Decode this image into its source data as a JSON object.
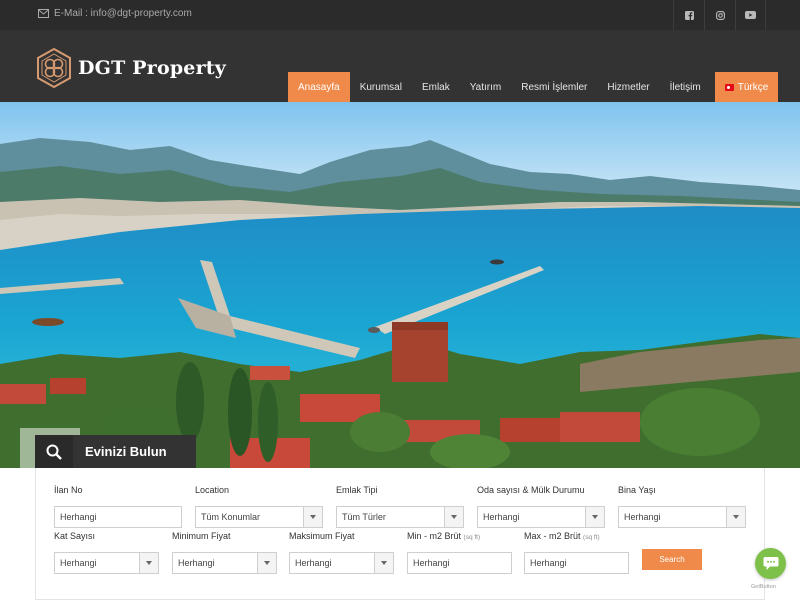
{
  "topbar": {
    "email": "E-Mail : info@dgt-property.com",
    "social_icons": [
      "facebook-icon",
      "instagram-icon",
      "youtube-icon"
    ]
  },
  "header": {
    "brand": "DGT Property",
    "nav": [
      {
        "label": "Anasayfa",
        "active": true
      },
      {
        "label": "Kurumsal"
      },
      {
        "label": "Emlak"
      },
      {
        "label": "Yatırım"
      },
      {
        "label": "Resmi İşlemler"
      },
      {
        "label": "Hizmetler"
      },
      {
        "label": "İletişim"
      }
    ],
    "language": "Türkçe"
  },
  "search": {
    "title": "Evinizi Bulun",
    "row1": [
      {
        "label": "İlan No",
        "value": "Herhangi"
      },
      {
        "label": "Location",
        "value": "Tüm Konumlar"
      },
      {
        "label": "Emlak Tipi",
        "value": "Tüm Türler"
      },
      {
        "label": "Oda sayısı & Mülk Durumu",
        "value": "Herhangi"
      },
      {
        "label": "Bina Yaşı",
        "value": "Herhangi"
      }
    ],
    "row2": [
      {
        "label": "Kat Sayısı",
        "value": "Herhangi"
      },
      {
        "label": "Minimum Fiyat",
        "value": "Herhangi"
      },
      {
        "label": "Maksimum Fiyat",
        "value": "Herhangi"
      },
      {
        "label": "Min - m2 Brüt",
        "unit": "(sq ft)",
        "placeholder": "Herhangi"
      },
      {
        "label": "Max - m2 Brüt",
        "unit": "(sq ft)",
        "placeholder": "Herhangi"
      }
    ],
    "button": "Search"
  },
  "widget": {
    "brand": "GetButton"
  },
  "colors": {
    "accent": "#ef8a4a",
    "dark": "#333333",
    "topbar": "#2b2b2b",
    "chat": "#7ec14a"
  }
}
